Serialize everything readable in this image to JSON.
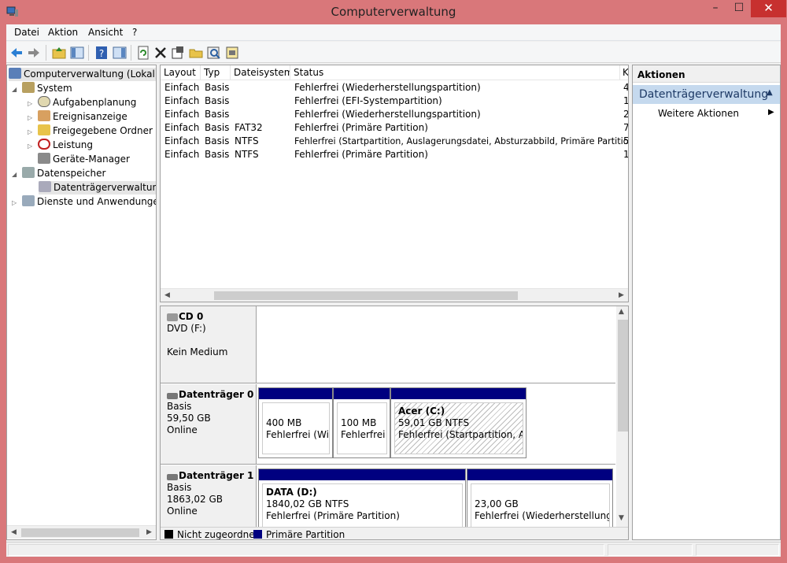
{
  "window": {
    "title": "Computerverwaltung",
    "minimize": "–",
    "maximize": "☐",
    "close": "✕"
  },
  "menu": [
    "Datei",
    "Aktion",
    "Ansicht",
    "?"
  ],
  "toolbar": [
    "back-icon",
    "forward-icon",
    "up-folder-icon",
    "show-hide-tree-icon",
    "help-icon",
    "show-hide-action-pane-icon",
    "refresh-icon",
    "delete-icon",
    "properties-icon",
    "open-icon",
    "magnify-icon",
    "disk-settings-icon"
  ],
  "tree": {
    "root": "Computerverwaltung (Lokal)",
    "system": "System",
    "task_scheduler": "Aufgabenplanung",
    "event_viewer": "Ereignisanzeige",
    "shared_folders": "Freigegebene Ordner",
    "performance": "Leistung",
    "device_manager": "Geräte-Manager",
    "storage": "Datenspeicher",
    "disk_management": "Datenträgerverwaltung",
    "services": "Dienste und Anwendungen"
  },
  "volumes": {
    "columns": [
      "Layout",
      "Typ",
      "Dateisystem",
      "Status",
      "K"
    ],
    "rows": [
      {
        "layout": "Einfach",
        "type": "Basis",
        "fs": "",
        "status": "Fehlerfrei (Wiederherstellungspartition)",
        "k": "4"
      },
      {
        "layout": "Einfach",
        "type": "Basis",
        "fs": "",
        "status": "Fehlerfrei (EFI-Systempartition)",
        "k": "1"
      },
      {
        "layout": "Einfach",
        "type": "Basis",
        "fs": "",
        "status": "Fehlerfrei (Wiederherstellungspartition)",
        "k": "2"
      },
      {
        "layout": "Einfach",
        "type": "Basis",
        "fs": "FAT32",
        "status": "Fehlerfrei (Primäre Partition)",
        "k": "7"
      },
      {
        "layout": "Einfach",
        "type": "Basis",
        "fs": "NTFS",
        "status": "Fehlerfrei (Startpartition, Auslagerungsdatei, Absturzabbild, Primäre Partition)",
        "k": "5"
      },
      {
        "layout": "Einfach",
        "type": "Basis",
        "fs": "NTFS",
        "status": "Fehlerfrei (Primäre Partition)",
        "k": "1"
      }
    ]
  },
  "disks": {
    "cd0": {
      "name": "CD 0",
      "type": "DVD (F:)",
      "media": "Kein Medium"
    },
    "disk0": {
      "name": "Datenträger 0",
      "type": "Basis",
      "size": "59,50 GB",
      "state": "Online",
      "p1": {
        "size": "400 MB",
        "status": "Fehlerfrei (Wiede"
      },
      "p2": {
        "size": "100 MB",
        "status": "Fehlerfrei ("
      },
      "p3": {
        "label": "Acer  (C:)",
        "size": "59,01 GB NTFS",
        "status": "Fehlerfrei (Startpartition, Ausla"
      }
    },
    "disk1": {
      "name": "Datenträger 1",
      "type": "Basis",
      "size": "1863,02 GB",
      "state": "Online",
      "p1": {
        "label": "DATA  (D:)",
        "size": "1840,02 GB NTFS",
        "status": "Fehlerfrei (Primäre Partition)"
      },
      "p2": {
        "size": "23,00 GB",
        "status": "Fehlerfrei (Wiederherstellungspa"
      }
    }
  },
  "legend": {
    "unallocated": "Nicht zugeordnet",
    "primary": "Primäre Partition"
  },
  "actions": {
    "header": "Aktionen",
    "section": "Datenträgerverwaltung",
    "more": "Weitere Aktionen"
  },
  "colors": {
    "accent": "#000080",
    "section_bg": "#c5d9ee",
    "frame": "#d9777a"
  }
}
